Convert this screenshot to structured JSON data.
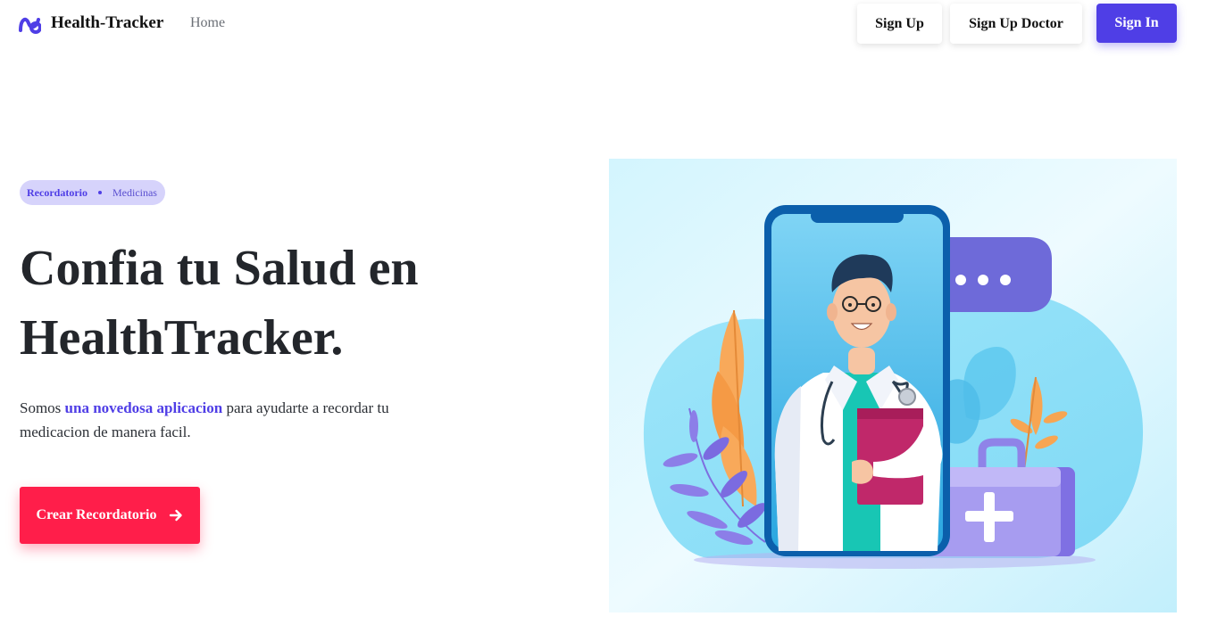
{
  "nav": {
    "brand": "Health-Tracker",
    "home_link": "Home",
    "signup_label": "Sign Up",
    "signup_doctor_label": "Sign Up Doctor",
    "signin_label": "Sign In"
  },
  "hero": {
    "tag_primary": "Recordatorio",
    "tag_secondary": "Medicinas",
    "title_line1": "Confia tu Salud en",
    "title_line2": "HealthTracker.",
    "text_before": "Somos ",
    "text_highlight": "una novedosa aplicacion",
    "text_after": " para ayudarte a recordar tu medicacion de manera facil.",
    "cta_label": "Crear Recordatorio",
    "cta_icon": "arrow-right-icon",
    "illustration_icon": "doctor-phone-illustration"
  },
  "colors": {
    "accent": "#4f3ee6",
    "cta": "#ff1e4a",
    "tag_bg": "#d6d3fb",
    "illustration_bg": "#c6f0fd"
  }
}
